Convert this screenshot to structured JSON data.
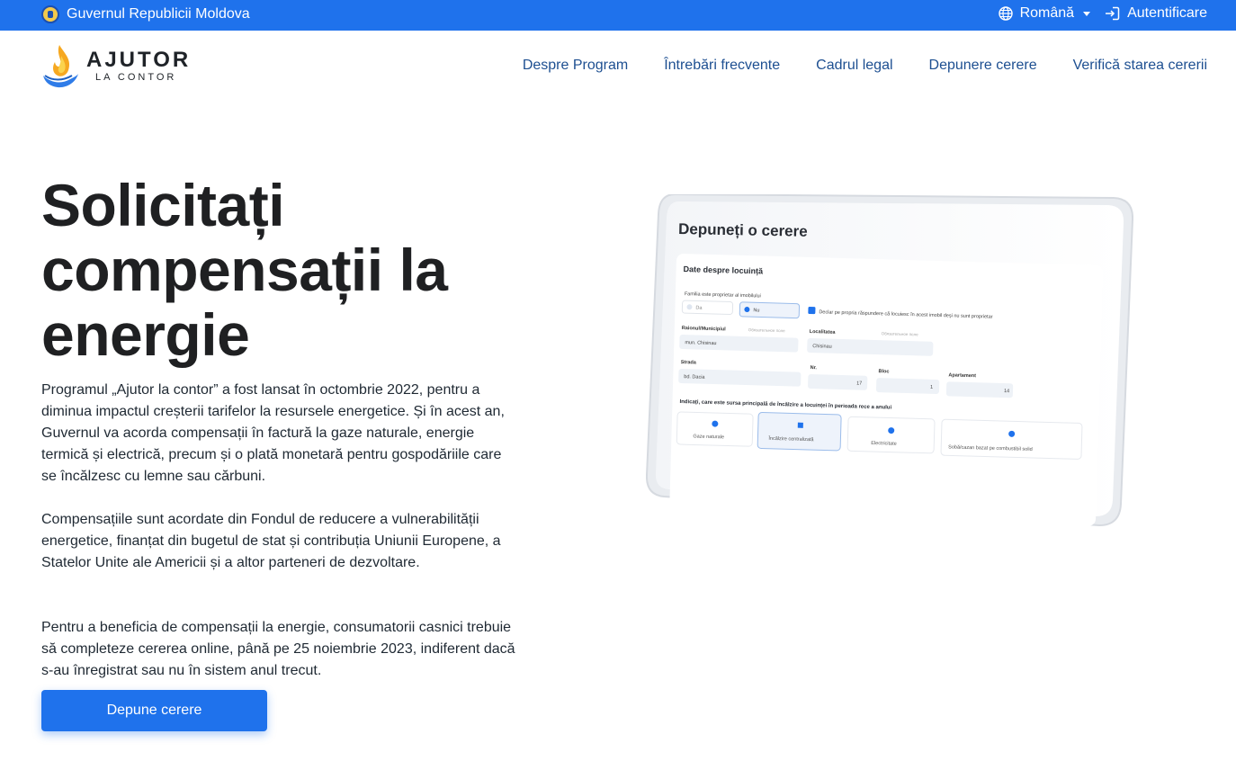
{
  "topbar": {
    "gov_name": "Guvernul Republicii Moldova",
    "language": "Română",
    "login": "Autentificare"
  },
  "logo": {
    "main": "AJUTOR",
    "sub": "LA CONTOR"
  },
  "nav": [
    "Despre Program",
    "Întrebări frecvente",
    "Cadrul legal",
    "Depunere cerere",
    "Verifică starea cererii"
  ],
  "hero": {
    "title_lines": [
      "Solicitați",
      "compensații la",
      "energie"
    ],
    "paragraphs": [
      "Programul „Ajutor la contor” a fost lansat în octombrie 2022, pentru a diminua impactul creșterii tarifelor la resursele energetice. Și în acest an, Guvernul va acorda compensații în factură la gaze naturale, energie termică și electrică, precum și o plată monetară pentru gospodăriile care se încălzesc cu lemne sau cărbuni.",
      "Compensațiile sunt acordate din Fondul de reducere a vulnerabilității energetice, finanțat din bugetul de stat și contribuția Uniunii Europene, a Statelor Unite ale Americii și a altor parteneri de dezvoltare.",
      "Pentru a beneficia de compensații la energie, consumatorii casnici trebuie să completeze cererea online, până pe 25 noiembrie 2023, indiferent dacă s-au înregistrat sau nu în sistem anul trecut."
    ],
    "cta": "Depune cerere"
  },
  "mockup": {
    "title": "Depuneți o cerere",
    "section": "Date despre locuință",
    "owner_question": "Familia este proprietar al imobilului",
    "opt_yes": "Da",
    "opt_no": "Nu",
    "declaration": "Declar pe propria răspundere că locuiesc în acest imobil deși nu sunt proprietar",
    "district_label": "Raionul/Municipiul",
    "required_hint": "Обязательное поле",
    "district_value": "mun. Chisinau",
    "locality_label": "Localitatea",
    "locality_value": "Chisinau",
    "street_label": "Strada",
    "street_value": "bd. Dacia",
    "nr_label": "Nr.",
    "nr_value": "17",
    "block_label": "Bloc",
    "block_value": "1",
    "apt_label": "Apartament",
    "apt_value": "14",
    "heating_question": "Indicați, care este sursa principală de încălzire a locuinței în perioada rece a anului",
    "heating_options": [
      "Gaze naturale",
      "Încălzire centralizată",
      "Electricitate",
      "Sobă/cazan bazat pe combustibil solid"
    ]
  },
  "colors": {
    "primary": "#1f72ec",
    "nav_text": "#1d4f91",
    "title": "#1f2022"
  }
}
